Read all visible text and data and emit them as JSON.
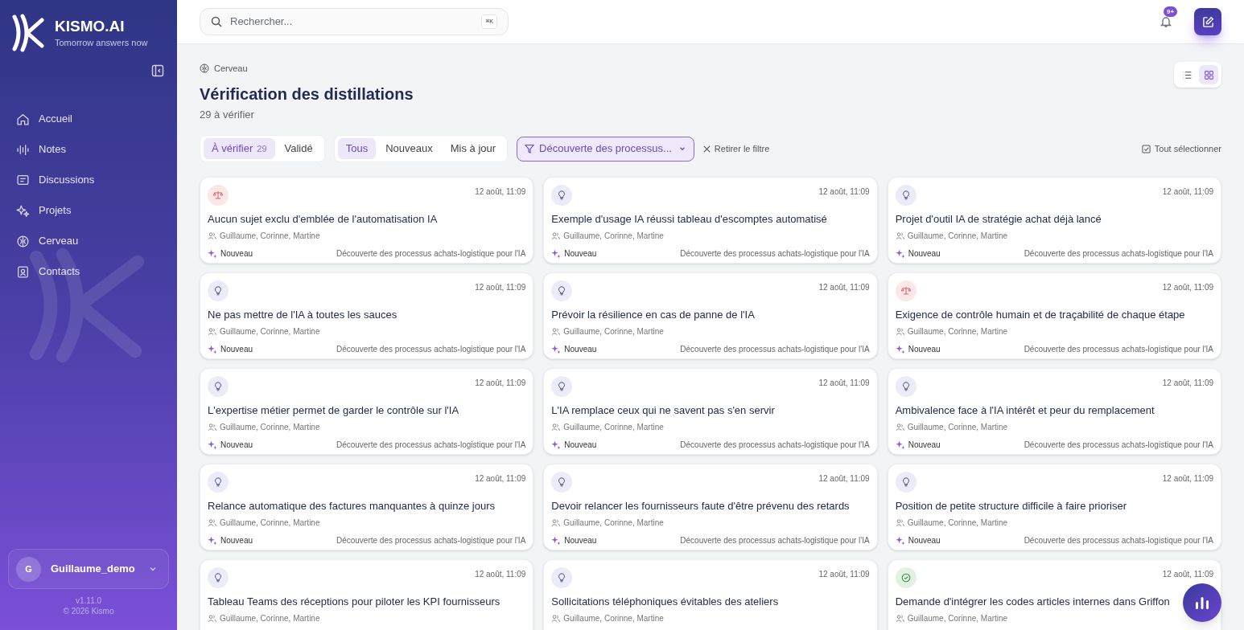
{
  "brand": {
    "name": "KISMO.AI",
    "tagline": "Tomorrow answers now"
  },
  "sidebar": {
    "items": [
      {
        "label": "Accueil"
      },
      {
        "label": "Notes"
      },
      {
        "label": "Discussions"
      },
      {
        "label": "Projets"
      },
      {
        "label": "Cerveau"
      },
      {
        "label": "Contacts"
      }
    ],
    "user": {
      "initial": "G",
      "name": "Guillaume_demo"
    },
    "version": "v1.11.0",
    "copyright": "© 2026 Kismo"
  },
  "search": {
    "placeholder": "Rechercher...",
    "shortcut": "⌘K"
  },
  "notifications": {
    "badge": "9+"
  },
  "breadcrumb": "Cerveau",
  "title": "Vérification des distillations",
  "subtitle": "29 à vérifier",
  "view_toggle": [
    {
      "kind": "list",
      "selected": false
    },
    {
      "kind": "grid",
      "selected": true
    }
  ],
  "status_tabs": [
    {
      "label": "À vérifier",
      "count": "29",
      "selected": true
    },
    {
      "label": "Validé",
      "selected": false
    }
  ],
  "type_tabs": [
    {
      "label": "Tous",
      "selected": true
    },
    {
      "label": "Nouveaux",
      "selected": false
    },
    {
      "label": "Mis à jour",
      "selected": false
    }
  ],
  "filter": {
    "label": "Découverte des processus...",
    "clear": "Retirer le filtre"
  },
  "select_all": "Tout sélectionner",
  "cards": [
    {
      "kind": "decision",
      "date": "12 août, 11:09",
      "title": "Aucun sujet exclu d'emblée de l'automatisation IA",
      "people": "Guillaume, Corinne, Martine",
      "status": "Nouveau",
      "project": "Découverte des processus achats-logistique pour l'IA"
    },
    {
      "kind": "idea",
      "date": "12 août, 11:09",
      "title": "Exemple d'usage IA réussi tableau d'escomptes automatisé",
      "people": "Guillaume, Corinne, Martine",
      "status": "Nouveau",
      "project": "Découverte des processus achats-logistique pour l'IA"
    },
    {
      "kind": "idea",
      "date": "12 août, 11:09",
      "title": "Projet d'outil IA de stratégie achat déjà lancé",
      "people": "Guillaume, Corinne, Martine",
      "status": "Nouveau",
      "project": "Découverte des processus achats-logistique pour l'IA"
    },
    {
      "kind": "idea",
      "date": "12 août, 11:09",
      "title": "Ne pas mettre de l'IA à toutes les sauces",
      "people": "Guillaume, Corinne, Martine",
      "status": "Nouveau",
      "project": "Découverte des processus achats-logistique pour l'IA"
    },
    {
      "kind": "idea",
      "date": "12 août, 11:09",
      "title": "Prévoir la résilience en cas de panne de l'IA",
      "people": "Guillaume, Corinne, Martine",
      "status": "Nouveau",
      "project": "Découverte des processus achats-logistique pour l'IA"
    },
    {
      "kind": "decision",
      "date": "12 août, 11:09",
      "title": "Exigence de contrôle humain et de traçabilité de chaque étape",
      "people": "Guillaume, Corinne, Martine",
      "status": "Nouveau",
      "project": "Découverte des processus achats-logistique pour l'IA"
    },
    {
      "kind": "idea",
      "date": "12 août, 11:09",
      "title": "L'expertise métier permet de garder le contrôle sur l'IA",
      "people": "Guillaume, Corinne, Martine",
      "status": "Nouveau",
      "project": "Découverte des processus achats-logistique pour l'IA"
    },
    {
      "kind": "idea",
      "date": "12 août, 11:09",
      "title": "L'IA remplace ceux qui ne savent pas s'en servir",
      "people": "Guillaume, Corinne, Martine",
      "status": "Nouveau",
      "project": "Découverte des processus achats-logistique pour l'IA"
    },
    {
      "kind": "idea",
      "date": "12 août, 11:09",
      "title": "Ambivalence face à l'IA intérêt et peur du remplacement",
      "people": "Guillaume, Corinne, Martine",
      "status": "Nouveau",
      "project": "Découverte des processus achats-logistique pour l'IA"
    },
    {
      "kind": "idea",
      "date": "12 août, 11:09",
      "title": "Relance automatique des factures manquantes à quinze jours",
      "people": "Guillaume, Corinne, Martine",
      "status": "Nouveau",
      "project": "Découverte des processus achats-logistique pour l'IA"
    },
    {
      "kind": "idea",
      "date": "12 août, 11:09",
      "title": "Devoir relancer les fournisseurs faute d'être prévenu des retards",
      "people": "Guillaume, Corinne, Martine",
      "status": "Nouveau",
      "project": "Découverte des processus achats-logistique pour l'IA"
    },
    {
      "kind": "idea",
      "date": "12 août, 11:09",
      "title": "Position de petite structure difficile à faire prioriser",
      "people": "Guillaume, Corinne, Martine",
      "status": "Nouveau",
      "project": "Découverte des processus achats-logistique pour l'IA"
    },
    {
      "kind": "idea",
      "date": "12 août, 11:09",
      "title": "Tableau Teams des réceptions pour piloter les KPI fournisseurs",
      "people": "Guillaume, Corinne, Martine"
    },
    {
      "kind": "idea",
      "date": "12 août, 11:09",
      "title": "Sollicitations téléphoniques évitables des ateliers",
      "people": "Guillaume, Corinne, Martine"
    },
    {
      "kind": "validated",
      "date": "12 août, 11:09",
      "title": "Demande d'intégrer les codes articles internes dans Griffon",
      "people": "Guillaume, Corinne, Martine"
    }
  ]
}
